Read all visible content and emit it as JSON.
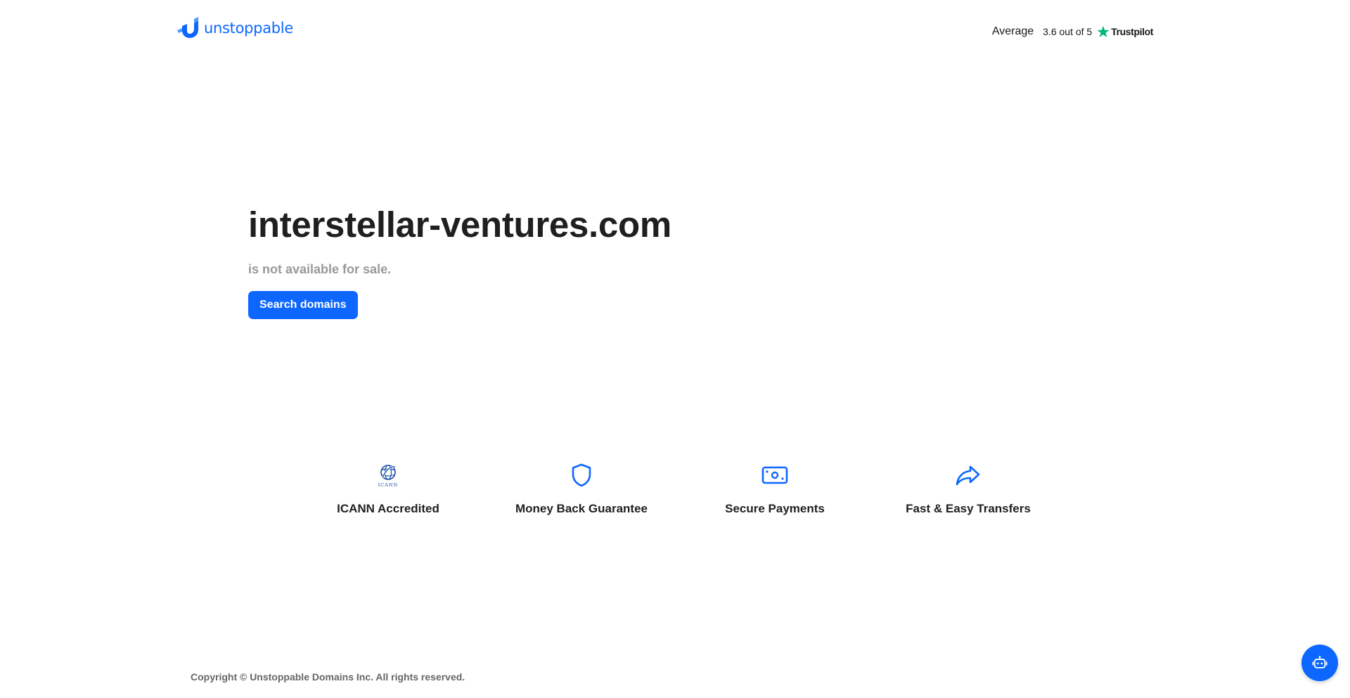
{
  "header": {
    "logo_text": "unstoppable",
    "rating": {
      "label": "Average",
      "score": "3.6 out of 5",
      "provider": "Trustpilot"
    }
  },
  "hero": {
    "domain": "interstellar-ventures.com",
    "status": "is not available for sale.",
    "button_label": "Search domains"
  },
  "features": [
    {
      "label": "ICANN Accredited",
      "icon": "icann-logo-icon",
      "icon_text": "ICANN"
    },
    {
      "label": "Money Back Guarantee",
      "icon": "shield-icon"
    },
    {
      "label": "Secure Payments",
      "icon": "money-icon"
    },
    {
      "label": "Fast & Easy Transfers",
      "icon": "share-arrow-icon"
    }
  ],
  "footer": {
    "copyright": "Copyright © Unstoppable Domains Inc. All rights reserved."
  },
  "chat": {
    "icon": "robot-icon"
  },
  "colors": {
    "brand": "#0d67fe",
    "trustpilot_green": "#00b67a",
    "muted_text": "#999999"
  }
}
